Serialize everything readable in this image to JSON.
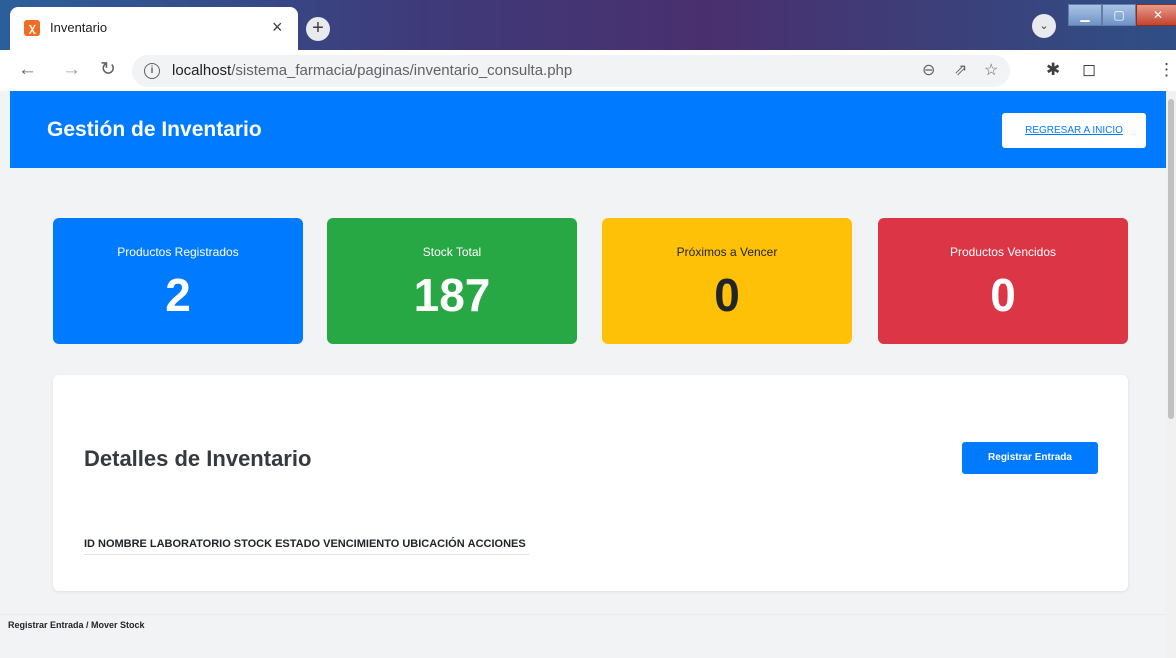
{
  "browser": {
    "tab_title": "Inventario",
    "tab_favicon": "xampp-icon",
    "tab_close": "×",
    "new_tab": "+",
    "url_host": "localhost",
    "url_path": "/sistema_farmacia/paginas/inventario_consulta.php"
  },
  "header": {
    "title": "Gestión de Inventario",
    "back_button": "REGRESAR A INICIO",
    "color": "#007bff"
  },
  "stats": [
    {
      "label": "Productos Registrados",
      "value": "2",
      "color": "#007bff"
    },
    {
      "label": "Stock Total",
      "value": "187",
      "color": "#28a745"
    },
    {
      "label": "Próximos a Vencer",
      "value": "0",
      "color": "#ffc107"
    },
    {
      "label": "Productos Vencidos",
      "value": "0",
      "color": "#dc3545"
    }
  ],
  "panel": {
    "title": "Detalles de Inventario",
    "button": "Registrar Entrada",
    "columns": [
      "ID",
      "NOMBRE",
      "LABORATORIO",
      "STOCK",
      "ESTADO",
      "VENCIMIENTO",
      "UBICACIÓN",
      "ACCIONES"
    ]
  },
  "footer": {
    "text": "Registrar Entrada / Mover Stock"
  }
}
